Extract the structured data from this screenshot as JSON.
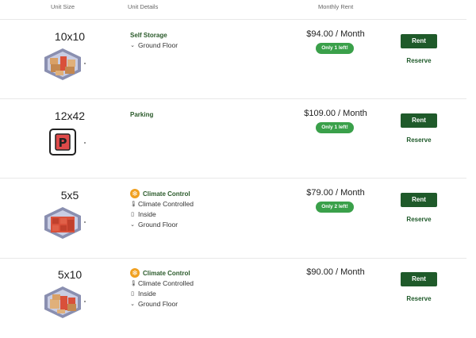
{
  "headers": {
    "unit_size": "Unit Size",
    "unit_details": "Unit Details",
    "monthly_rent": "Monthly Rent"
  },
  "colors": {
    "rent_button": "#1f5a2a",
    "badge": "#3aa04a",
    "category_text": "#2a5a2a",
    "climate_icon": "#f0a020"
  },
  "units": [
    {
      "size": "10x10",
      "image": "storage-unit-boxes-icon",
      "category": "Self Storage",
      "features": [
        {
          "icon": "chevron-down-icon",
          "label": "Ground Floor"
        }
      ],
      "price": "$94.00 / Month",
      "badge": "Only 1 left!",
      "rent": "Rent",
      "reserve": "Reserve"
    },
    {
      "size": "12x42",
      "image": "parking-icon",
      "category": "Parking",
      "features": [],
      "price": "$109.00 / Month",
      "badge": "Only 1 left!",
      "rent": "Rent",
      "reserve": "Reserve"
    },
    {
      "size": "5x5",
      "image": "storage-unit-boxes-icon",
      "category": "Climate Control",
      "features": [
        {
          "icon": "thermometer-icon",
          "label": "Climate Controlled"
        },
        {
          "icon": "building-icon",
          "label": "Inside"
        },
        {
          "icon": "chevron-down-icon",
          "label": "Ground Floor"
        }
      ],
      "price": "$79.00 / Month",
      "badge": "Only 2 left!",
      "rent": "Rent",
      "reserve": "Reserve"
    },
    {
      "size": "5x10",
      "image": "storage-unit-boxes-icon",
      "category": "Climate Control",
      "features": [
        {
          "icon": "thermometer-icon",
          "label": "Climate Controlled"
        },
        {
          "icon": "building-icon",
          "label": "Inside"
        },
        {
          "icon": "chevron-down-icon",
          "label": "Ground Floor"
        }
      ],
      "price": "$90.00 / Month",
      "badge": "",
      "rent": "Rent",
      "reserve": "Reserve"
    }
  ]
}
